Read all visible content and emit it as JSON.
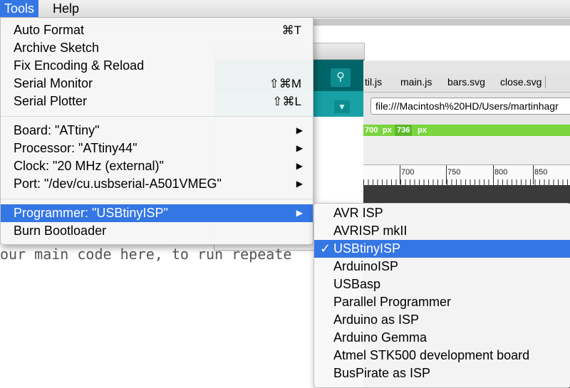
{
  "menubar": {
    "tools": "Tools",
    "help": "Help"
  },
  "tools_menu": {
    "items": [
      {
        "label": "Auto Format",
        "shortcut": "⌘T"
      },
      {
        "label": "Archive Sketch",
        "shortcut": ""
      },
      {
        "label": "Fix Encoding & Reload",
        "shortcut": ""
      },
      {
        "label": "Serial Monitor",
        "shortcut": "⇧⌘M"
      },
      {
        "label": "Serial Plotter",
        "shortcut": "⇧⌘L"
      },
      {
        "label": "Board: \"ATtiny\"",
        "submenu": true
      },
      {
        "label": "Processor: \"ATtiny44\"",
        "submenu": true
      },
      {
        "label": "Clock: \"20 MHz (external)\"",
        "submenu": true
      },
      {
        "label": "Port: \"/dev/cu.usbserial-A501VMEG\"",
        "submenu": true
      },
      {
        "label": "Programmer: \"USBtinyISP\"",
        "submenu": true,
        "highlighted": true
      },
      {
        "label": "Burn Bootloader"
      }
    ],
    "submenu_arrow": "▶"
  },
  "programmer_submenu": {
    "items": [
      {
        "label": "AVR ISP"
      },
      {
        "label": "AVRISP mkII"
      },
      {
        "label": "USBtinyISP",
        "checked": true,
        "highlighted": true
      },
      {
        "label": "ArduinoISP"
      },
      {
        "label": "USBasp"
      },
      {
        "label": "Parallel Programmer"
      },
      {
        "label": "Arduino as ISP"
      },
      {
        "label": "Arduino Gemma"
      },
      {
        "label": "Atmel STK500 development board"
      },
      {
        "label": "BusPirate as ISP"
      }
    ],
    "check_mark": "✓"
  },
  "editor": {
    "code_line": "our main code here, to run repeate"
  },
  "browser": {
    "tabs": [
      "til.js",
      "main.js",
      "bars.svg",
      "close.svg"
    ],
    "url": "file:///Macintosh%20HD/Users/martinhagr",
    "green_bar": {
      "a": "700",
      "a_unit": "px",
      "b": "736",
      "b_unit": "px"
    },
    "ruler_ticks": [
      "700",
      "750",
      "800",
      "850"
    ]
  },
  "colors": {
    "highlight": "#3476e4",
    "arduino_teal": "#006468",
    "arduino_tab": "#17a1a5",
    "green_bar": "#7ad53e"
  },
  "icons": {
    "serial_monitor": "magnifier-icon",
    "tab_menu": "chevron-down-icon"
  }
}
